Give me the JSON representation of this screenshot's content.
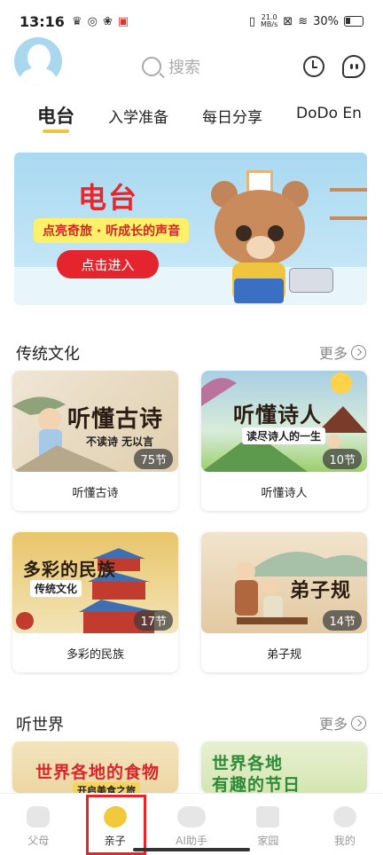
{
  "status": {
    "time": "13:16",
    "net_speed_top": "21.0",
    "net_speed_bottom": "MB/s",
    "battery": "30%"
  },
  "header": {
    "search_placeholder": "搜索"
  },
  "tabs": [
    {
      "label": "电台",
      "active": true
    },
    {
      "label": "入学准备",
      "active": false
    },
    {
      "label": "每日分享",
      "active": false
    },
    {
      "label": "DoDo En",
      "active": false
    }
  ],
  "banner": {
    "title": "电台",
    "subtitle": "点亮奇旅 · 听成长的声音",
    "button": "点击进入"
  },
  "sections": [
    {
      "title": "传统文化",
      "more": "更多",
      "cards": [
        {
          "label": "听懂古诗",
          "badge": "75节",
          "img_title": "听懂古诗",
          "img_sub": "不读诗 无以言"
        },
        {
          "label": "听懂诗人",
          "badge": "10节",
          "img_title": "听懂诗人",
          "img_sub": "读尽诗人的一生"
        },
        {
          "label": "多彩的民族",
          "badge": "17节",
          "img_title": "多彩的民族",
          "img_sub": "传统文化"
        },
        {
          "label": "弟子规",
          "badge": "14节",
          "img_title": "弟子规",
          "img_sub": ""
        }
      ]
    },
    {
      "title": "听世界",
      "more": "更多",
      "cards": [
        {
          "img_title": "世界各地的食物",
          "img_sub": "开启美食之旅"
        },
        {
          "img_title": "世界各地",
          "img_title_2": "有趣的节日"
        }
      ]
    }
  ],
  "bottom_nav": [
    {
      "label": "父母",
      "active": false
    },
    {
      "label": "亲子",
      "active": true
    },
    {
      "label": "AI助手",
      "active": false
    },
    {
      "label": "家园",
      "active": false
    },
    {
      "label": "我的",
      "active": false
    }
  ],
  "colors": {
    "accent": "#f3c23c",
    "highlight": "#e3262b",
    "banner_red": "#e5252e"
  }
}
